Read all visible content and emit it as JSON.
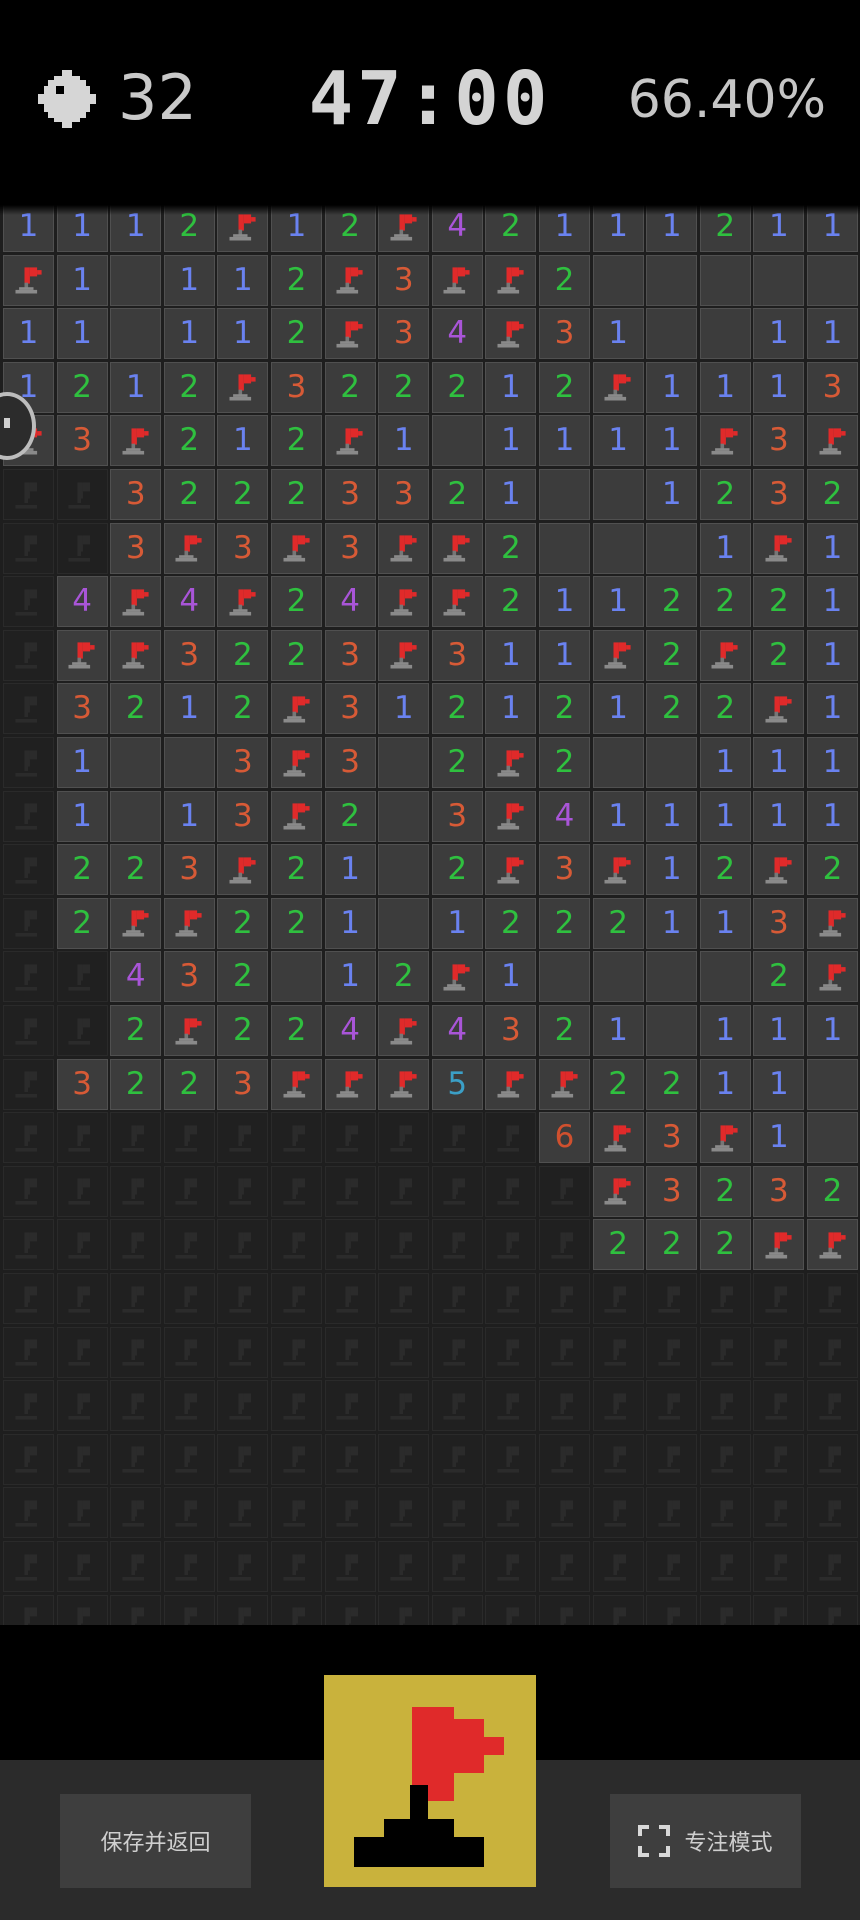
{
  "header": {
    "mines_remaining": "32",
    "timer": "47:00",
    "progress": "66.40%"
  },
  "footer": {
    "save_label": "保存并返回",
    "focus_label": "专注模式"
  },
  "colors": {
    "flag_red": "#e02a2a",
    "flag_mode_button": "#c9b23c",
    "open_cell": "#3c3c3c",
    "closed_cell": "#202020"
  },
  "board": {
    "cols": 16,
    "legend": {
      "F": "flag",
      ".": "revealed-empty",
      "#": "unrevealed",
      "1-9": "number"
    },
    "rows": [
      "1112F12F4211121 1",
      "F1.112F3FF2.....",
      "11.112F34F31..11",
      "1212F322212F111 3F",
      "F3F212F1.1111F3F",
      "##32223321..1232",
      "##3F3F3FF2...1F1",
      "#4F4F24FF211222 1",
      "#FF3223F311F2F21",
      "#3212F31212122F1",
      "#1..3F3.2F2..111",
      "#1.13F2.3F411111",
      "#223F21.2F3F12F2",
      "#2FF221.122211 3F3",
      "##432.12F1....2F2",
      "##2F224F432 1.111",
      "#3223FFF5FF2211.",
      "##########6F3F1.",
      "###########F323 2",
      "###########222FF",
      "################",
      "################",
      "################",
      "################",
      "################",
      "################",
      "################"
    ]
  }
}
